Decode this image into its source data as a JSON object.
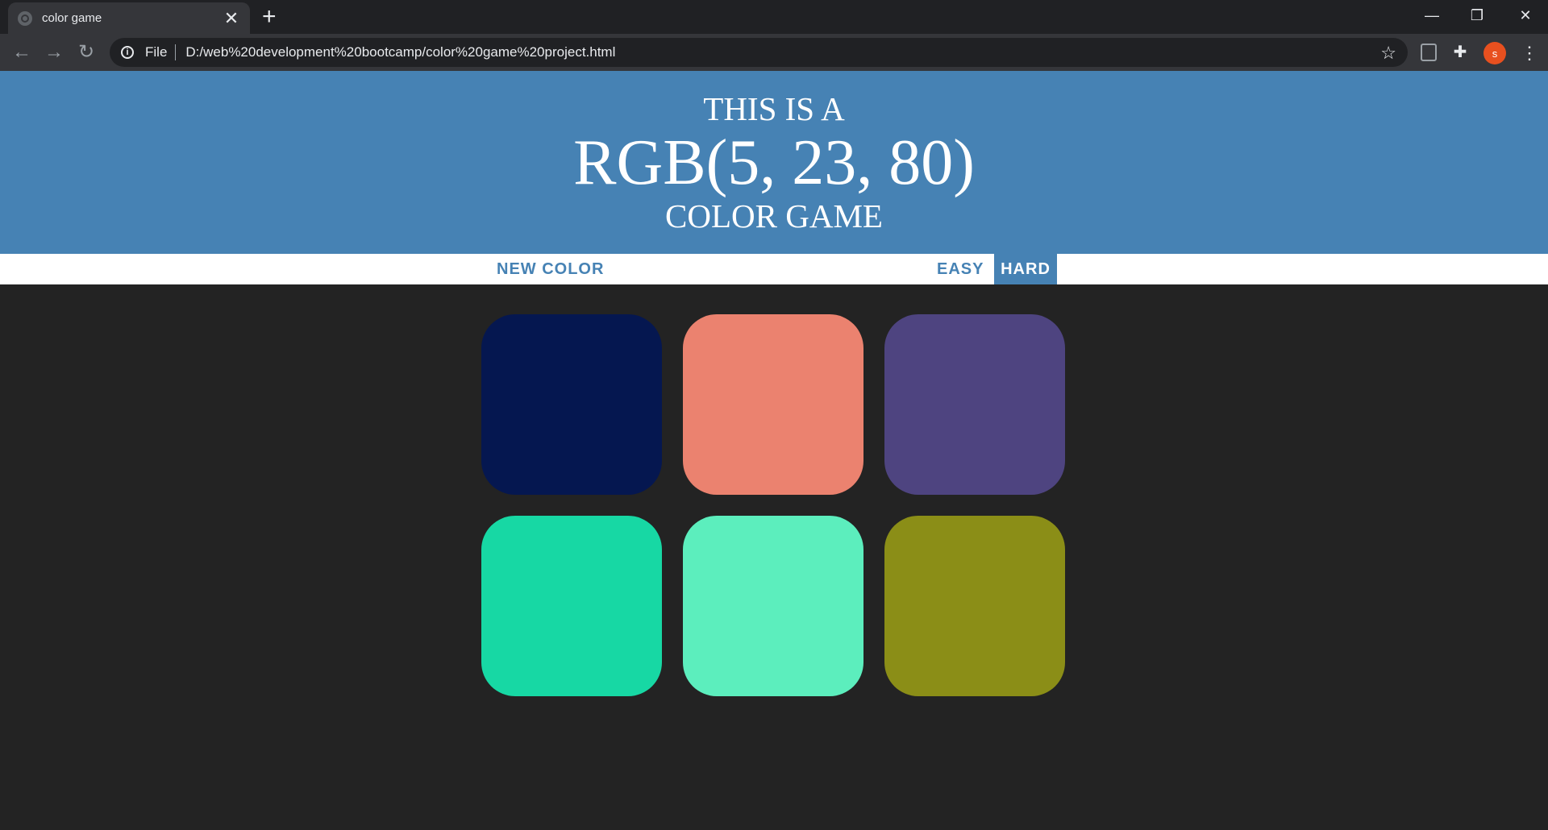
{
  "browser": {
    "tab_title": "color game",
    "tab_close": "✕",
    "new_tab": "+",
    "back": "←",
    "forward": "→",
    "reload": "↻",
    "info": "i",
    "scheme_label": "File",
    "url": "D:/web%20development%20bootcamp/color%20game%20project.html",
    "bookmark": "☆",
    "extensions": "✚",
    "avatar_initial": "s",
    "menu": "⋮",
    "minimize": "—",
    "restore": "❐",
    "close": "✕"
  },
  "header": {
    "line1": "THIS IS A",
    "rgb": "RGB(5, 23, 80)",
    "line3": "COLOR GAME"
  },
  "stripe": {
    "new_color": "NEW COLOR",
    "easy": "EASY",
    "hard": "HARD"
  },
  "colors": {
    "header_bg": "#4682b4",
    "page_bg": "#232323",
    "squares": [
      "#051750",
      "#eb826f",
      "#4e4480",
      "#17d8a4",
      "#5ceebd",
      "#8b8e17"
    ]
  }
}
